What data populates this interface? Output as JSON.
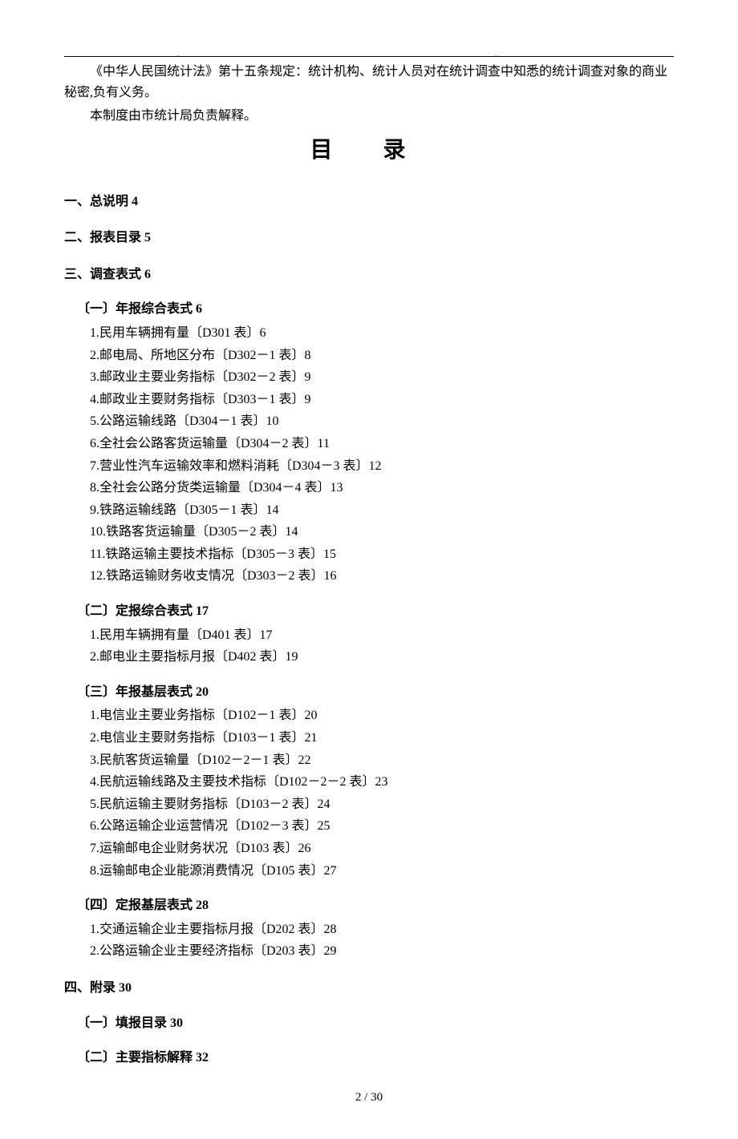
{
  "intro": {
    "line1": "《中华人民国统计法》第十五条规定：统计机构、统计人员对在统计调查中知悉的统计调查对象的商业秘密,负有义务。",
    "line2": "本制度由市统计局负责解释。"
  },
  "title": "目 录",
  "sections": [
    {
      "label": "一、总说明 4"
    },
    {
      "label": "二、报表目录 5"
    },
    {
      "label": "三、调查表式 6",
      "subs": [
        {
          "label": "〔一〕年报综合表式 6",
          "items": [
            "1.民用车辆拥有量〔D301 表〕6",
            "2.邮电局、所地区分布〔D302－1 表〕8",
            "3.邮政业主要业务指标〔D302－2 表〕9",
            "4.邮政业主要财务指标〔D303－1 表〕9",
            "5.公路运输线路〔D304－1 表〕10",
            "6.全社会公路客货运输量〔D304－2 表〕11",
            "7.营业性汽车运输效率和燃料消耗〔D304－3 表〕12",
            "8.全社会公路分货类运输量〔D304－4 表〕13",
            "9.铁路运输线路〔D305－1 表〕14",
            "10.铁路客货运输量〔D305－2 表〕14",
            "11.铁路运输主要技术指标〔D305－3 表〕15",
            "12.铁路运输财务收支情况〔D303－2 表〕16"
          ]
        },
        {
          "label": "〔二〕定报综合表式 17",
          "items": [
            "1.民用车辆拥有量〔D401 表〕17",
            "2.邮电业主要指标月报〔D402 表〕19"
          ]
        },
        {
          "label": "〔三〕年报基层表式 20",
          "items": [
            "1.电信业主要业务指标〔D102－1 表〕20",
            "2.电信业主要财务指标〔D103－1 表〕21",
            "3.民航客货运输量〔D102－2－1 表〕22",
            "4.民航运输线路及主要技术指标〔D102－2－2 表〕23",
            "5.民航运输主要财务指标〔D103－2 表〕24",
            "6.公路运输企业运营情况〔D102－3 表〕25",
            "7.运输邮电企业财务状况〔D103 表〕26",
            "8.运输邮电企业能源消费情况〔D105 表〕27"
          ]
        },
        {
          "label": "〔四〕定报基层表式 28",
          "items": [
            "1.交通运输企业主要指标月报〔D202 表〕28",
            "2.公路运输企业主要经济指标〔D203 表〕29"
          ]
        }
      ]
    },
    {
      "label": "四、附录 30",
      "subs": [
        {
          "label": "〔一〕填报目录 30",
          "items": []
        },
        {
          "label": "〔二〕主要指标解释 32",
          "items": []
        }
      ]
    }
  ],
  "pagenum": "2 / 30"
}
